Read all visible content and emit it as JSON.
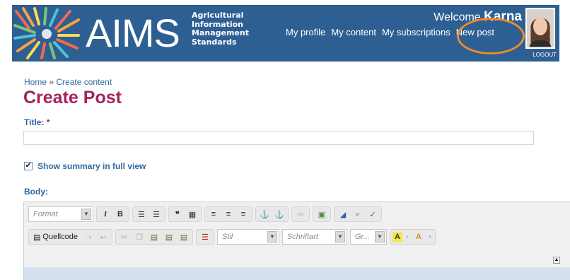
{
  "header": {
    "logo_text": "AIMS",
    "tagline": [
      "Agricultural",
      "Information",
      "Management",
      "Standards"
    ],
    "welcome_prefix": "Welcome",
    "user_name": "Karna",
    "nav": [
      "My profile",
      "My content",
      "My subscriptions",
      "New post"
    ],
    "logout": "LOGOUT",
    "background_color": "#2e5f93",
    "highlight_color": "#ec8a2c"
  },
  "breadcrumb": {
    "home": "Home",
    "separator": "»",
    "current": "Create content"
  },
  "page_title": "Create Post",
  "form": {
    "title_label": "Title:",
    "required_marker": "*",
    "title_value": "",
    "summary_checkbox_label": "Show summary in full view",
    "summary_checked": true,
    "body_label": "Body:"
  },
  "editor": {
    "format_placeholder": "Format",
    "style_placeholder": "Stil",
    "font_placeholder": "Schriftart",
    "size_placeholder": "Gr...",
    "source_label": "Quellcode"
  },
  "colors": {
    "title": "#a5225a",
    "link": "#2e6aa0"
  }
}
